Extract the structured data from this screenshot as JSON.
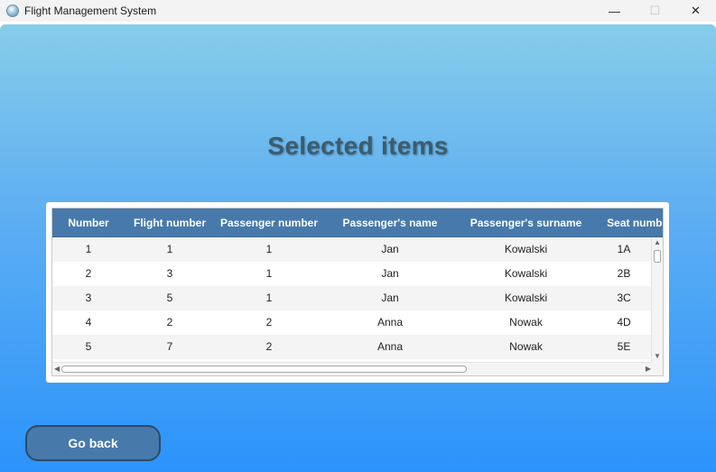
{
  "window": {
    "title": "Flight Management System",
    "controls": {
      "minimize": "—",
      "maximize": "☐",
      "close": "✕"
    }
  },
  "main": {
    "heading": "Selected items",
    "back_button_label": "Go back"
  },
  "table": {
    "columns": [
      "Number",
      "Flight number",
      "Passenger number",
      "Passenger's name",
      "Passenger's surname",
      "Seat number"
    ],
    "rows": [
      [
        "1",
        "1",
        "1",
        "Jan",
        "Kowalski",
        "1A"
      ],
      [
        "2",
        "3",
        "1",
        "Jan",
        "Kowalski",
        "2B"
      ],
      [
        "3",
        "5",
        "1",
        "Jan",
        "Kowalski",
        "3C"
      ],
      [
        "4",
        "2",
        "2",
        "Anna",
        "Nowak",
        "4D"
      ],
      [
        "5",
        "7",
        "2",
        "Anna",
        "Nowak",
        "5E"
      ]
    ]
  },
  "colors": {
    "header_bg": "#4779ab",
    "gradient_top": "#86cdea",
    "gradient_bottom": "#2b93fb",
    "heading_text": "#3c5c6e"
  }
}
